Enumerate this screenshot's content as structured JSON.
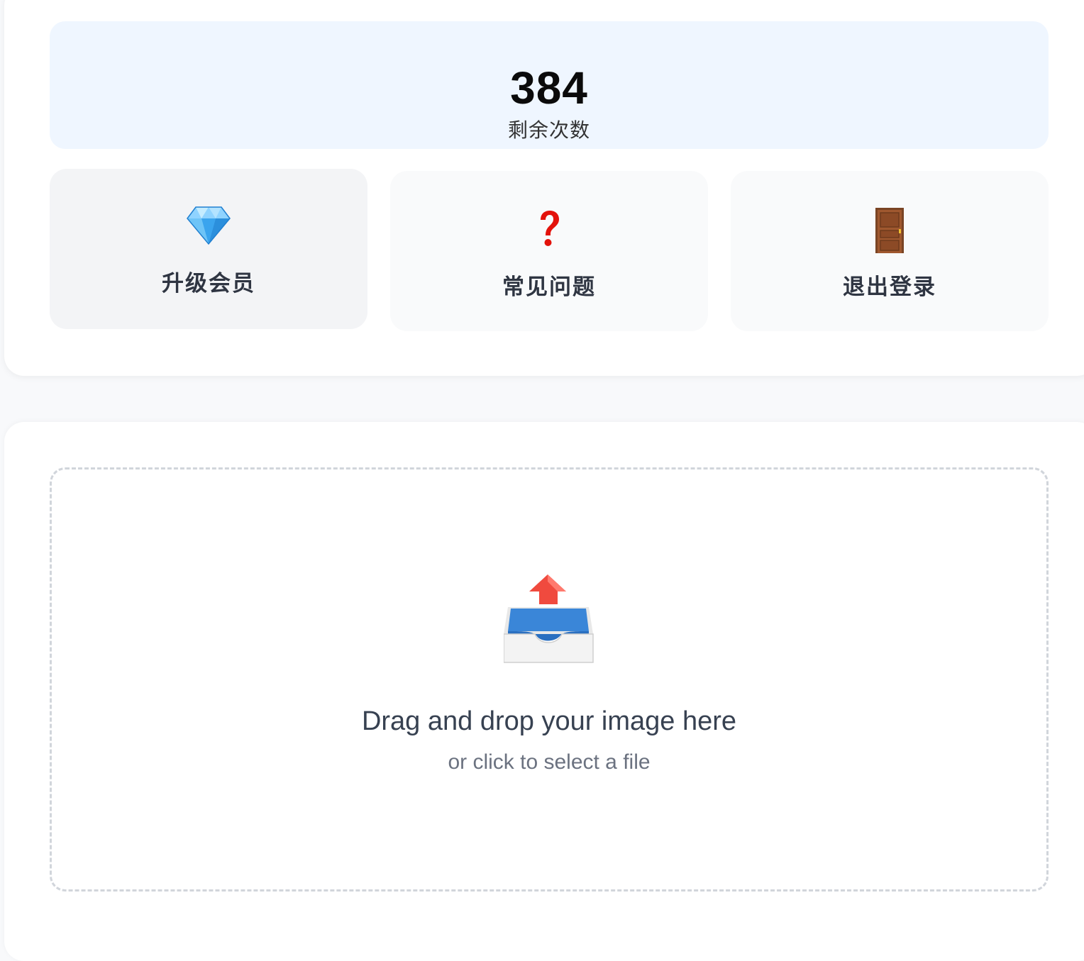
{
  "balance": {
    "value": "384",
    "label": "剩余次数"
  },
  "actions": [
    {
      "icon": "gem-icon",
      "label": "升级会员"
    },
    {
      "icon": "question-mark-icon",
      "label": "常见问题"
    },
    {
      "icon": "door-icon",
      "label": "退出登录"
    }
  ],
  "upload": {
    "icon": "outbox-tray-icon",
    "title": "Drag and drop your image here",
    "subtitle": "or click to select a file"
  },
  "colors": {
    "balance_bg": "#eff6ff",
    "card_bg": "#ffffff",
    "page_bg": "#f8f9fb",
    "dropzone_border": "#d1d5db"
  }
}
